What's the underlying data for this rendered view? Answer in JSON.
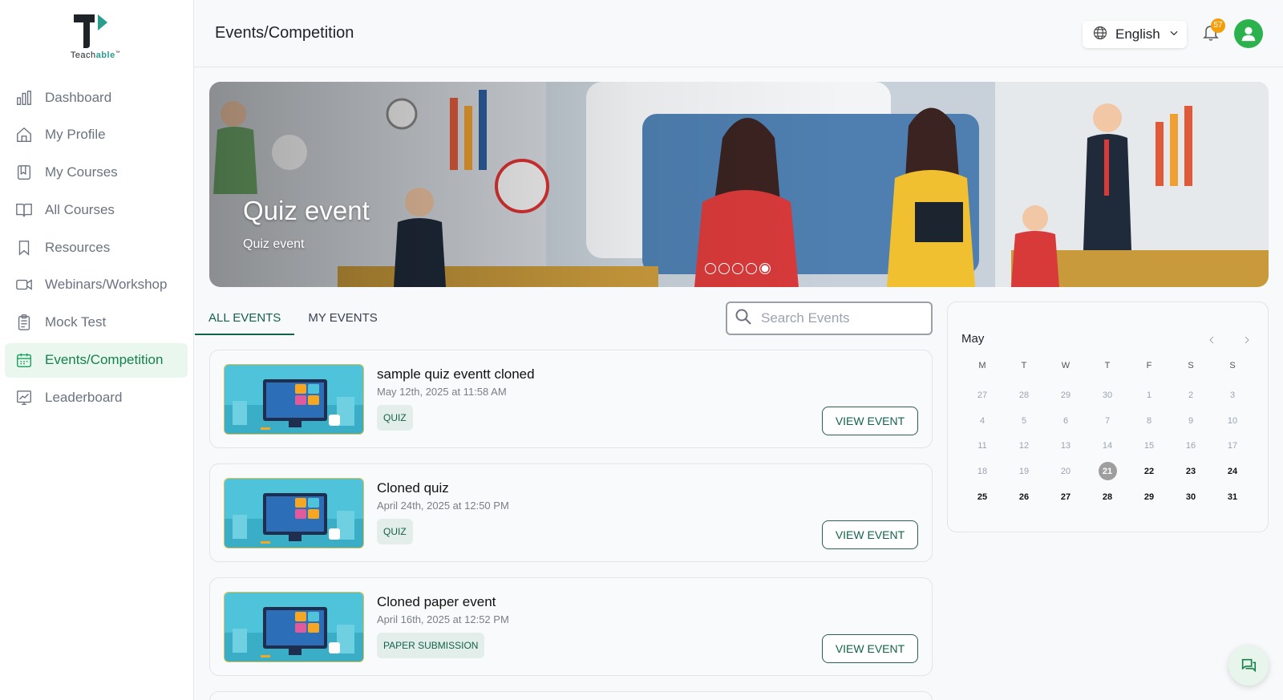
{
  "brand": {
    "logo_text_main": "Teach",
    "logo_text_accent": "able",
    "logo_tm": "™",
    "accent_color": "#2a9d8f"
  },
  "sidebar": {
    "items": [
      {
        "label": "Dashboard",
        "icon": "bar-chart-icon",
        "active": false
      },
      {
        "label": "My Profile",
        "icon": "home-icon",
        "active": false
      },
      {
        "label": "My Courses",
        "icon": "book-square-icon",
        "active": false
      },
      {
        "label": "All Courses",
        "icon": "open-book-icon",
        "active": false
      },
      {
        "label": "Resources",
        "icon": "bookmark-icon",
        "active": false
      },
      {
        "label": "Webinars/Workshop",
        "icon": "video-icon",
        "active": false
      },
      {
        "label": "Mock Test",
        "icon": "clipboard-icon",
        "active": false
      },
      {
        "label": "Events/Competition",
        "icon": "calendar-icon",
        "active": true
      },
      {
        "label": "Leaderboard",
        "icon": "trend-chart-icon",
        "active": false
      }
    ],
    "active_color": "#17a05a"
  },
  "header": {
    "title": "Events/Competition",
    "language": "English",
    "notification_count": "57"
  },
  "banner": {
    "title": "Quiz event",
    "subtitle": "Quiz event",
    "slide_count": 5,
    "active_slide": 5
  },
  "tabs": [
    {
      "label": "ALL EVENTS",
      "active": true
    },
    {
      "label": "MY EVENTS",
      "active": false
    }
  ],
  "search": {
    "placeholder": "Search Events",
    "value": ""
  },
  "events": [
    {
      "title": "sample quiz eventt cloned",
      "date": "May 12th, 2025 at 11:58 AM",
      "tag": "QUIZ",
      "button": "VIEW EVENT"
    },
    {
      "title": "Cloned quiz",
      "date": "April 24th, 2025 at 12:50 PM",
      "tag": "QUIZ",
      "button": "VIEW EVENT"
    },
    {
      "title": "Cloned paper event",
      "date": "April 16th, 2025 at 12:52 PM",
      "tag": "PAPER SUBMISSION",
      "button": "VIEW EVENT"
    }
  ],
  "calendar": {
    "month": "May",
    "weekdays": [
      "M",
      "T",
      "W",
      "T",
      "F",
      "S",
      "S"
    ],
    "weeks": [
      [
        "27",
        "28",
        "29",
        "30",
        "1",
        "2",
        "3"
      ],
      [
        "4",
        "5",
        "6",
        "7",
        "8",
        "9",
        "10"
      ],
      [
        "11",
        "12",
        "13",
        "14",
        "15",
        "16",
        "17"
      ],
      [
        "18",
        "19",
        "20",
        "21",
        "22",
        "23",
        "24"
      ],
      [
        "25",
        "26",
        "27",
        "28",
        "29",
        "30",
        "31"
      ]
    ],
    "today": "21",
    "today_color": "#9e9e9e"
  },
  "chat": {
    "icon": "chat-icon"
  }
}
